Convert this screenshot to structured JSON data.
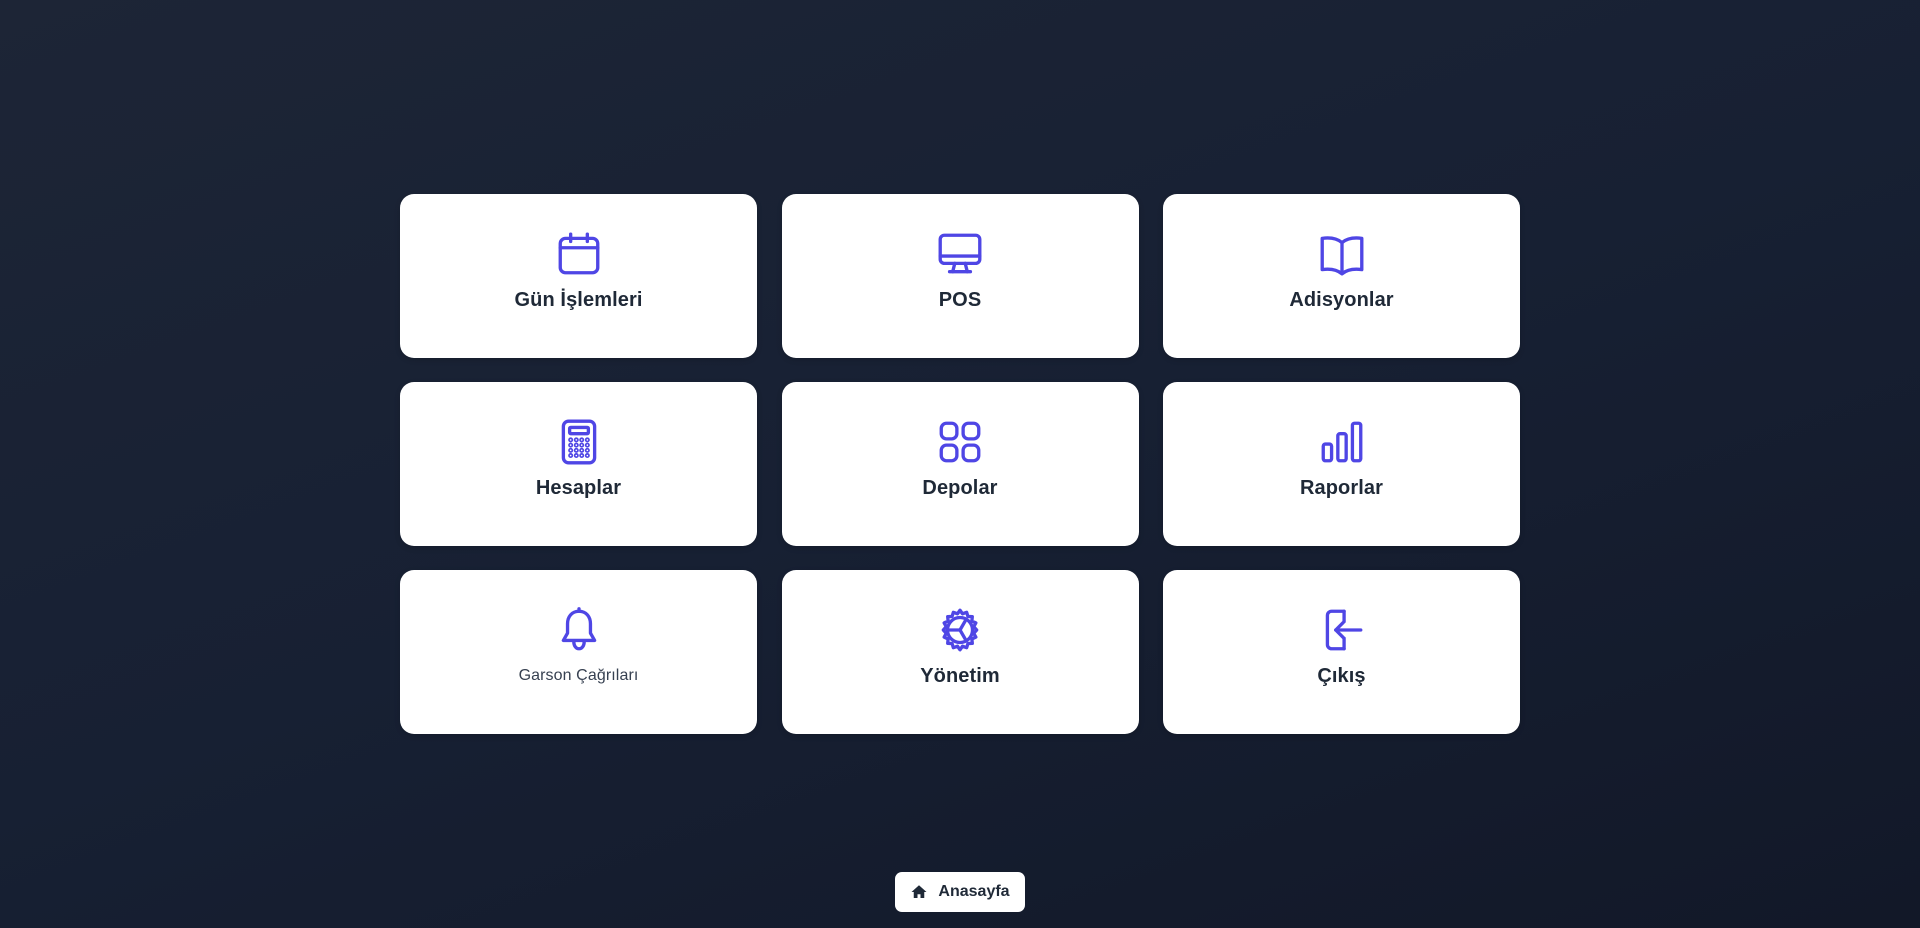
{
  "tiles": [
    {
      "label": "Gün İşlemleri",
      "icon": "calendar-icon"
    },
    {
      "label": "POS",
      "icon": "monitor-icon"
    },
    {
      "label": "Adisyonlar",
      "icon": "book-open-icon"
    },
    {
      "label": "Hesaplar",
      "icon": "calculator-icon"
    },
    {
      "label": "Depolar",
      "icon": "grid-icon"
    },
    {
      "label": "Raporlar",
      "icon": "bar-chart-icon"
    },
    {
      "label": "Garson Çağrıları",
      "icon": "bell-icon"
    },
    {
      "label": "Yönetim",
      "icon": "settings-cog-icon"
    },
    {
      "label": "Çıkış",
      "icon": "logout-icon"
    }
  ],
  "footer": {
    "home_label": "Anasayfa",
    "home_icon": "home-icon"
  },
  "colors": {
    "accent": "#4f46e5",
    "background": "#1a2234",
    "tile": "#ffffff",
    "text": "#1f2937"
  }
}
